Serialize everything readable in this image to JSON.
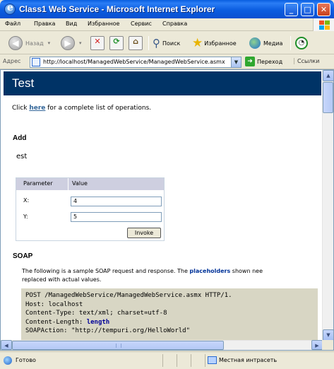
{
  "window": {
    "title": "Class1 Web Service - Microsoft Internet Explorer",
    "buttons": {
      "minimize": "_",
      "maximize": "□",
      "close": "✕"
    }
  },
  "menu": {
    "items": [
      "Файл",
      "Правка",
      "Вид",
      "Избранное",
      "Сервис",
      "Справка"
    ]
  },
  "toolbar": {
    "back_label": "Назад",
    "search_label": "Поиск",
    "favorites_label": "Избранное",
    "media_label": "Медиа"
  },
  "address": {
    "label": "Адрес",
    "url": "http://localhost/ManagedWebService/ManagedWebService.asmx",
    "go_label": "Переход",
    "links_label": "Ссылки"
  },
  "page": {
    "heading": "Test",
    "intro_prefix": "Click",
    "intro_link": "here",
    "intro_suffix": "for a complete list of operations.",
    "section_title": "Add",
    "op_name": "est",
    "table": {
      "col_parameter": "Parameter",
      "col_value": "Value",
      "rows": [
        {
          "name": "X:",
          "value": "4"
        },
        {
          "name": "Y:",
          "value": "5"
        }
      ],
      "invoke_label": "Invoke"
    },
    "soap_title": "SOAP",
    "soap_desc_1": "The following is a sample SOAP request and response. The",
    "soap_desc_link": "placeholders",
    "soap_desc_2": "shown nee",
    "soap_desc_3": "replaced with actual values.",
    "code_lines": [
      "POST /ManagedWebService/ManagedWebService.asmx HTTP/1.",
      "Host: localhost",
      "Content-Type: text/xml; charset=utf-8",
      "Content-Length: ",
      "SOAPAction: \"http://tempuri.org/HelloWorld\""
    ],
    "code_length_placeholder": "length"
  },
  "status": {
    "text": "Готово",
    "zone": "Местная интрасеть"
  }
}
